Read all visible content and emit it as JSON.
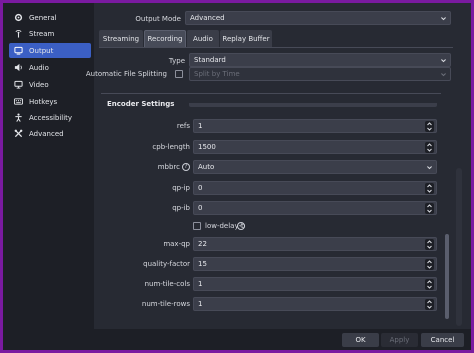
{
  "sidebar": {
    "items": [
      {
        "label": "General",
        "icon": "gear-icon"
      },
      {
        "label": "Stream",
        "icon": "antenna-icon"
      },
      {
        "label": "Output",
        "icon": "output-icon"
      },
      {
        "label": "Audio",
        "icon": "speaker-icon"
      },
      {
        "label": "Video",
        "icon": "monitor-icon"
      },
      {
        "label": "Hotkeys",
        "icon": "keyboard-icon"
      },
      {
        "label": "Accessibility",
        "icon": "accessibility-icon"
      },
      {
        "label": "Advanced",
        "icon": "wrench-icon"
      }
    ],
    "active_index": 2
  },
  "output_mode": {
    "label": "Output Mode",
    "value": "Advanced"
  },
  "tabs": [
    "Streaming",
    "Recording",
    "Audio",
    "Replay Buffer"
  ],
  "active_tab": "Recording",
  "type": {
    "label": "Type",
    "value": "Standard"
  },
  "file_splitting": {
    "label": "Automatic File Splitting",
    "value": "Split by Time",
    "checked": false
  },
  "encoder": {
    "title": "Encoder Settings",
    "refs": {
      "label": "refs",
      "value": "1"
    },
    "cpb_length": {
      "label": "cpb-length",
      "value": "1500"
    },
    "mbbrc": {
      "label": "mbbrc",
      "value": "Auto"
    },
    "qp_ip": {
      "label": "qp-ip",
      "value": "0"
    },
    "qp_ib": {
      "label": "qp-ib",
      "value": "0"
    },
    "low_delay_b": {
      "label": "low-delay-b",
      "checked": false
    },
    "max_qp": {
      "label": "max-qp",
      "value": "22"
    },
    "quality_factor": {
      "label": "quality-factor",
      "value": "15"
    },
    "num_tile_cols": {
      "label": "num-tile-cols",
      "value": "1"
    },
    "num_tile_rows": {
      "label": "num-tile-rows",
      "value": "1"
    }
  },
  "buttons": {
    "ok": "OK",
    "apply": "Apply",
    "cancel": "Cancel"
  },
  "colors": {
    "accent": "#3b5fc4",
    "window_bg": "#1d1f26",
    "panel_bg": "#272a33",
    "frame": "#7a1aa0"
  }
}
